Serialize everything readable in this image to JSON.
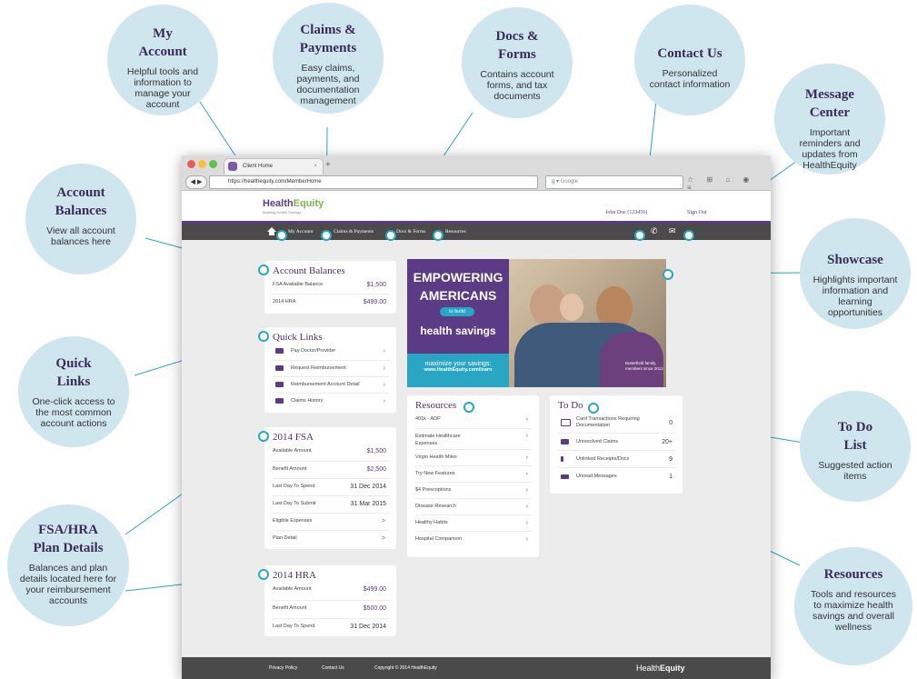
{
  "callouts": {
    "my_account": {
      "title_1": "My",
      "title_2": "Account",
      "desc": "Helpful tools and information to manage your account"
    },
    "claims": {
      "title_1": "Claims &",
      "title_2": "Payments",
      "desc": "Easy claims, payments, and documentation management"
    },
    "docs": {
      "title_1": "Docs &",
      "title_2": "Forms",
      "desc": "Contains account forms, and tax documents"
    },
    "contact": {
      "title_1": "Contact Us",
      "desc": "Personalized contact information"
    },
    "message": {
      "title_1": "Message",
      "title_2": "Center",
      "desc": "Important reminders and updates from HealthEquity"
    },
    "balances": {
      "title_1": "Account",
      "title_2": "Balances",
      "desc": "View all account balances here"
    },
    "showcase": {
      "title_1": "Showcase",
      "desc": "Highlights important information and learning opportunities"
    },
    "quick": {
      "title_1": "Quick",
      "title_2": "Links",
      "desc": "One-click access to the most common account actions"
    },
    "todo": {
      "title_1": "To Do",
      "title_2": "List",
      "desc": "Suggested action items"
    },
    "fsa_hra": {
      "title_1": "FSA/HRA",
      "title_2": "Plan Details",
      "desc": "Balances and plan details located here for your reimbursement accounts"
    },
    "resources": {
      "title_1": "Resources",
      "desc": "Tools and resources to maximize health savings and overall wellness"
    }
  },
  "browser": {
    "tab_title": "Client Home",
    "tab_close": "×",
    "new_tab": "+",
    "url": "https://healthequity.com/MemberHome",
    "search_placeholder": "Google"
  },
  "site": {
    "logo_main": "Health",
    "logo_accent": "Equity",
    "logo_sub": "Building Health Savings",
    "user": "John Doe (123456)",
    "sign_out": "Sign Out",
    "nav": [
      "My Account",
      "Claims & Payments",
      "Docs & Forms",
      "Resources"
    ]
  },
  "account_balances": {
    "title": "Account Balances",
    "rows": [
      {
        "label": "FSA Available Balance",
        "value": "$1,500"
      },
      {
        "label": "2014 HRA",
        "value": "$499.00"
      }
    ]
  },
  "quick_links": {
    "title": "Quick Links",
    "items": [
      "Pay Doctor/Provider",
      "Request Reimbursement",
      "Reimbursement Account Detail",
      "Claims History"
    ]
  },
  "fsa": {
    "title": "2014 FSA",
    "rows": [
      {
        "label": "Available Amount",
        "value": "$1,500"
      },
      {
        "label": "Benefit Amount",
        "value": "$2,500"
      },
      {
        "label": "Last Day To Spend",
        "value": "31 Dec 2014"
      },
      {
        "label": "Last Day To Submit",
        "value": "31 Mar 2015"
      },
      {
        "label": "Eligible Expenses",
        "value": ">"
      },
      {
        "label": "Plan Detail",
        "value": ">"
      }
    ]
  },
  "hra": {
    "title": "2014 HRA",
    "rows": [
      {
        "label": "Available Amount",
        "value": "$499.00"
      },
      {
        "label": "Benefit Amount",
        "value": "$500.00"
      },
      {
        "label": "Last Day To Spend",
        "value": "31 Dec 2014"
      }
    ]
  },
  "hero": {
    "line1": "EMPOWERING",
    "line2": "AMERICANS",
    "pill": "to build",
    "line3": "health savings",
    "tag1": "maximize your savings:",
    "tag2": "www.HealthEquity.com/learn",
    "caption1": "Butterfield family,",
    "caption2": "members since 2012"
  },
  "resources": {
    "title": "Resources",
    "items": [
      "401k - ADP",
      "Estimate Healthcare Expenses",
      "Virgin Health Miles",
      "Try New Features",
      "$4 Prescriptions",
      "Disease Research",
      "Healthy Habits",
      "Hospital Comparison"
    ]
  },
  "todo": {
    "title": "To Do",
    "items": [
      {
        "label": "Card Transactions Requiring Documentation",
        "count": "0"
      },
      {
        "label": "Unresolved Claims",
        "count": "20+"
      },
      {
        "label": "Unlinked Receipts/Docs",
        "count": "9"
      },
      {
        "label": "Unread Messages",
        "count": "1"
      }
    ]
  },
  "footer": {
    "privacy": "Privacy Policy",
    "contact": "Contact Us",
    "copyright": "Copyright © 2014 HealthEquity",
    "logo_main": "Health",
    "logo_accent": "Equity"
  },
  "colors": {
    "brand_purple": "#5b3a86",
    "accent_teal": "#28a6c4",
    "bubble": "#cfe6ef"
  }
}
